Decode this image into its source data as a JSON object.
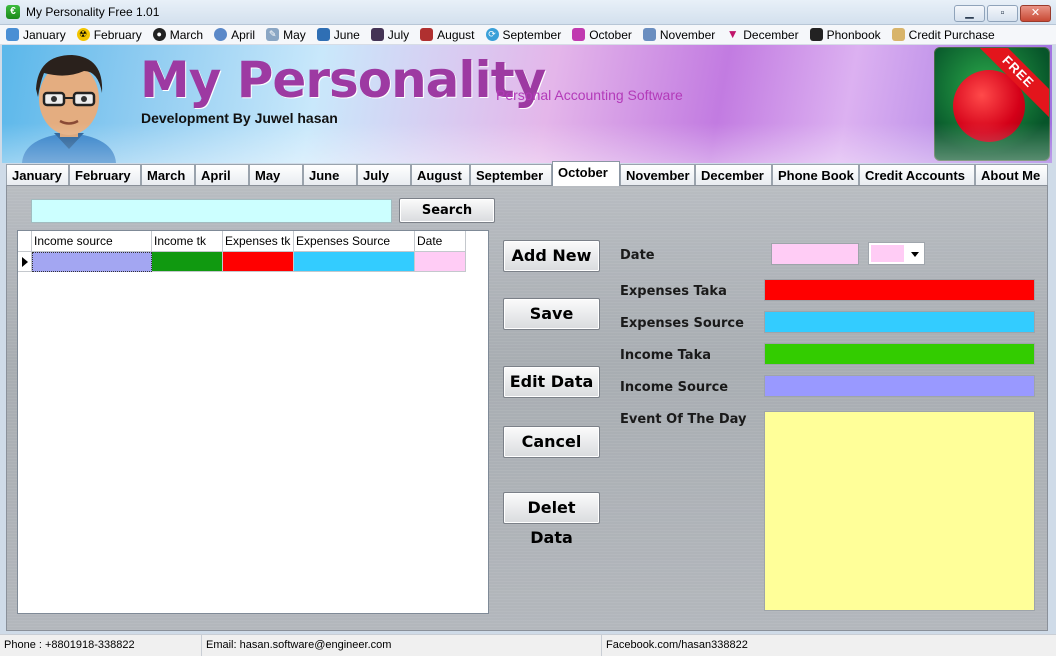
{
  "window": {
    "title": "My Personality Free 1.01",
    "icon": "app-icon",
    "buttons": {
      "minimize": "minimize-icon",
      "maximize": "maximize-icon",
      "close": "close-icon"
    }
  },
  "menubar": {
    "items": [
      {
        "label": "January",
        "icon": "monitor-icon"
      },
      {
        "label": "February",
        "icon": "radiation-icon"
      },
      {
        "label": "March",
        "icon": "film-reel-icon"
      },
      {
        "label": "April",
        "icon": "globe-icon"
      },
      {
        "label": "May",
        "icon": "pencil-icon"
      },
      {
        "label": "June",
        "icon": "laptop-icon"
      },
      {
        "label": "July",
        "icon": "computer-icon"
      },
      {
        "label": "August",
        "icon": "people-icon"
      },
      {
        "label": "September",
        "icon": "sync-icon"
      },
      {
        "label": "October",
        "icon": "tools-icon"
      },
      {
        "label": "November",
        "icon": "satellite-icon"
      },
      {
        "label": "December",
        "icon": "triangle-icon"
      },
      {
        "label": "Phonbook",
        "icon": "phonebook-icon"
      },
      {
        "label": "Credit Purchase",
        "icon": "hand-icon"
      }
    ]
  },
  "banner": {
    "title": "My Personality",
    "subtitle": "Personal Accounting Software",
    "developer": "Development By Juwel hasan",
    "badge": "FREE"
  },
  "tabs": {
    "items": [
      "January",
      "February",
      "March",
      "April",
      "May",
      "June",
      "July",
      "August",
      "September",
      "October",
      "November",
      "December",
      "Phone Book",
      "Credit Accounts",
      "About Me"
    ],
    "active": "October"
  },
  "search": {
    "value": "",
    "button_label": "Search"
  },
  "grid": {
    "columns": [
      "Income source",
      "Income tk",
      "Expenses tk",
      "Expenses Source",
      "Date"
    ],
    "rows": [
      {
        "cells": [
          "",
          "",
          "",
          "",
          ""
        ]
      }
    ],
    "cell_colors": [
      "#a3a6f2",
      "#109910",
      "#ff0000",
      "#33ccff",
      "#ffccf5"
    ]
  },
  "actions": {
    "add_new": "Add New",
    "save": "Save",
    "edit": "Edit Data",
    "cancel": "Cancel",
    "delete": "Delet Data"
  },
  "form": {
    "date_label": "Date",
    "expenses_taka_label": "Expenses Taka",
    "expenses_source_label": "Expenses Source",
    "income_taka_label": "Income Taka",
    "income_source_label": "Income Source",
    "event_label": "Event Of The Day",
    "date_value": "",
    "expenses_taka_value": "",
    "expenses_source_value": "",
    "income_taka_value": "",
    "income_source_value": "",
    "event_value": "",
    "colors": {
      "date": "#ffccf5",
      "expenses_taka": "#ff0000",
      "expenses_source": "#33ccff",
      "income_taka": "#33cc00",
      "income_source": "#9999ff",
      "event": "#ffff99"
    }
  },
  "statusbar": {
    "phone": "Phone : +8801918-338822",
    "email": "Email: hasan.software@engineer.com",
    "facebook": "Facebook.com/hasan338822"
  }
}
